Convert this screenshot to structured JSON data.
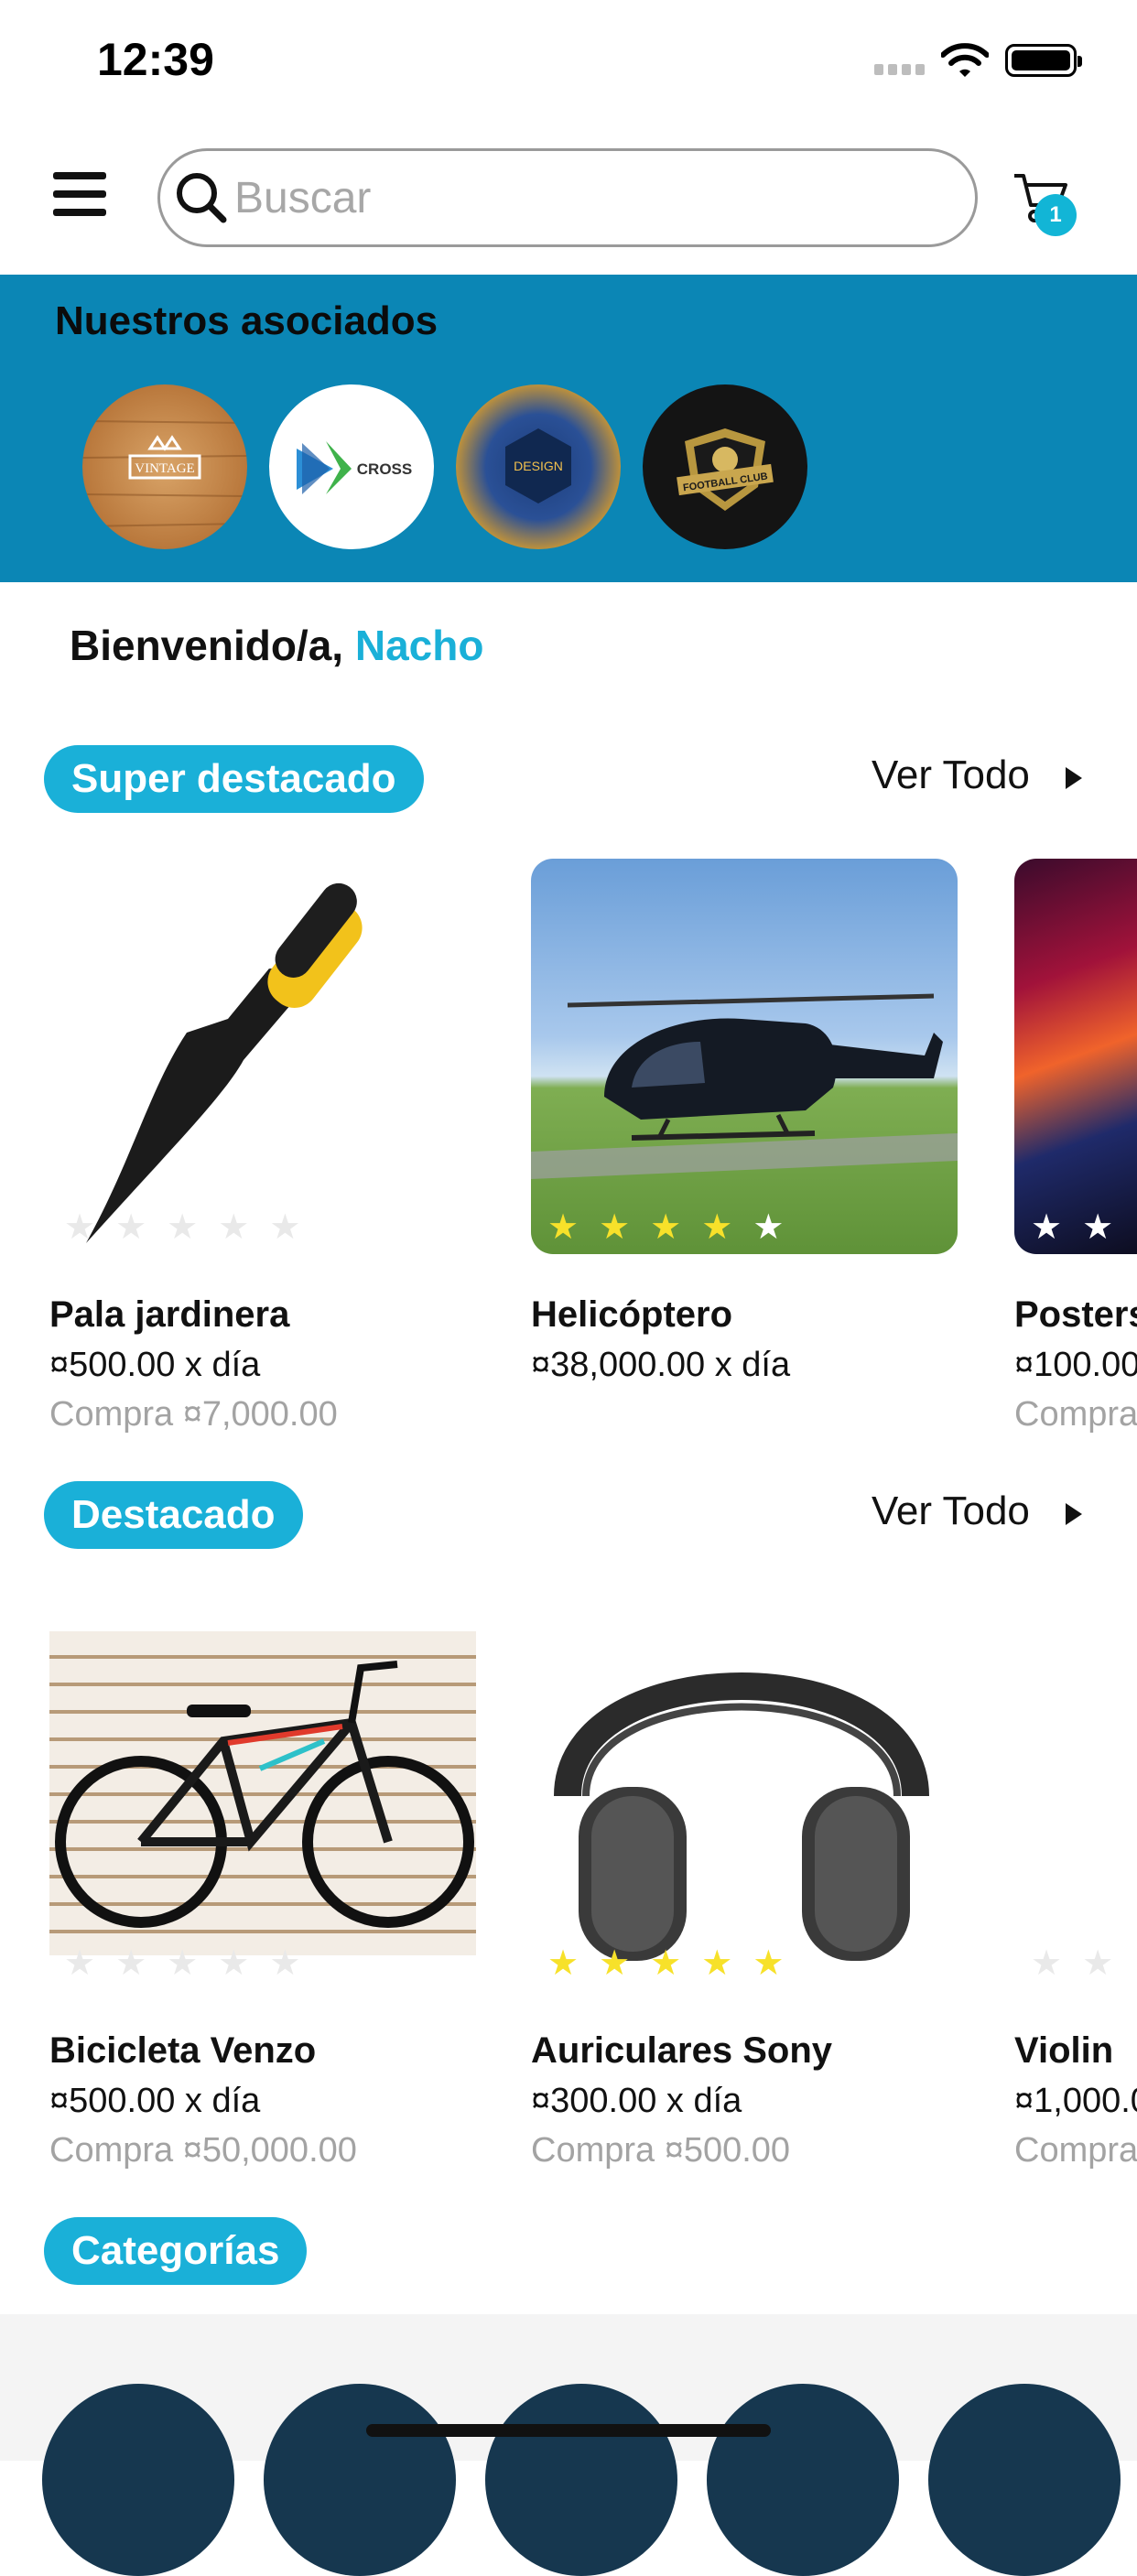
{
  "status_bar": {
    "time": "12:39"
  },
  "header": {
    "search_placeholder": "Buscar",
    "cart_count": "1"
  },
  "partners": {
    "title": "Nuestros asociados",
    "items": [
      {
        "label": "VINTAGE"
      },
      {
        "label": "CROSS"
      },
      {
        "label": "DESIGN"
      },
      {
        "label": "FOOTBALL CLUB"
      }
    ]
  },
  "welcome": {
    "prefix": "Bienvenido/a, ",
    "name": "Nacho"
  },
  "super_featured": {
    "title": "Super destacado",
    "see_all": "Ver Todo",
    "products": [
      {
        "name": "Pala jardinera",
        "price": "¤500.00 x día",
        "buy": "Compra ¤7,000.00",
        "rating": 0
      },
      {
        "name": "Helicóptero",
        "price": "¤38,000.00 x día",
        "buy": "",
        "rating": 4
      },
      {
        "name": "Posters",
        "price": "¤100.00",
        "buy": "Compra",
        "rating": 0
      }
    ]
  },
  "featured": {
    "title": "Destacado",
    "see_all": "Ver Todo",
    "products": [
      {
        "name": "Bicicleta Venzo",
        "price": "¤500.00 x día",
        "buy": "Compra ¤50,000.00",
        "rating": 0
      },
      {
        "name": "Auriculares Sony",
        "price": "¤300.00 x día",
        "buy": "Compra ¤500.00",
        "rating": 5
      },
      {
        "name": "Violin",
        "price": "¤1,000.0",
        "buy": "Compra",
        "rating": 0
      }
    ]
  },
  "categories": {
    "title": "Categorías"
  },
  "colors": {
    "accent": "#1ab0d8",
    "band": "#0b86b5",
    "star": "#f7e12a",
    "category": "#16374f"
  }
}
